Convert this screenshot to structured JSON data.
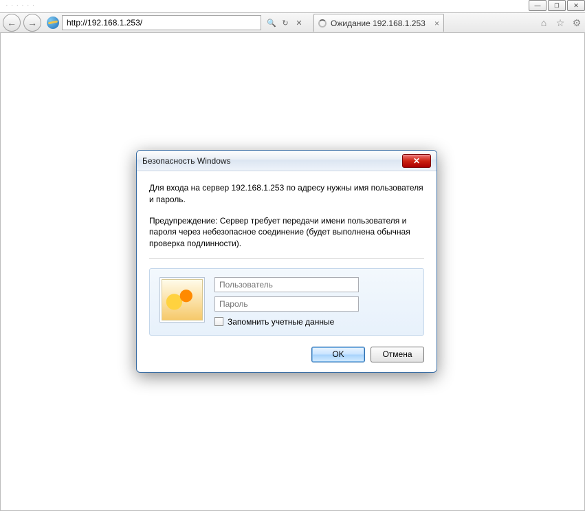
{
  "ghost_text": "·  ·  ·  ·  ·  ·",
  "window_controls": {
    "minimize": "—",
    "maximize": "❐",
    "close": "✕"
  },
  "nav": {
    "back": "←",
    "forward": "→"
  },
  "address": "http://192.168.1.253/",
  "toolbar_icons": {
    "search": "🔍",
    "refresh": "↻",
    "stop": "✕"
  },
  "tab": {
    "label": "Ожидание 192.168.1.253",
    "close": "×"
  },
  "tools": {
    "home": "⌂",
    "favorite": "☆",
    "settings": "⚙"
  },
  "dialog": {
    "title": "Безопасность Windows",
    "close": "✕",
    "message1": "Для входа на сервер 192.168.1.253 по адресу  нужны имя пользователя и пароль.",
    "message2": "Предупреждение: Сервер требует передачи имени пользователя и пароля через небезопасное соединение (будет выполнена обычная проверка подлинности).",
    "username_placeholder": "Пользователь",
    "password_placeholder": "Пароль",
    "remember_label": "Запомнить учетные данные",
    "ok": "OK",
    "cancel": "Отмена"
  }
}
